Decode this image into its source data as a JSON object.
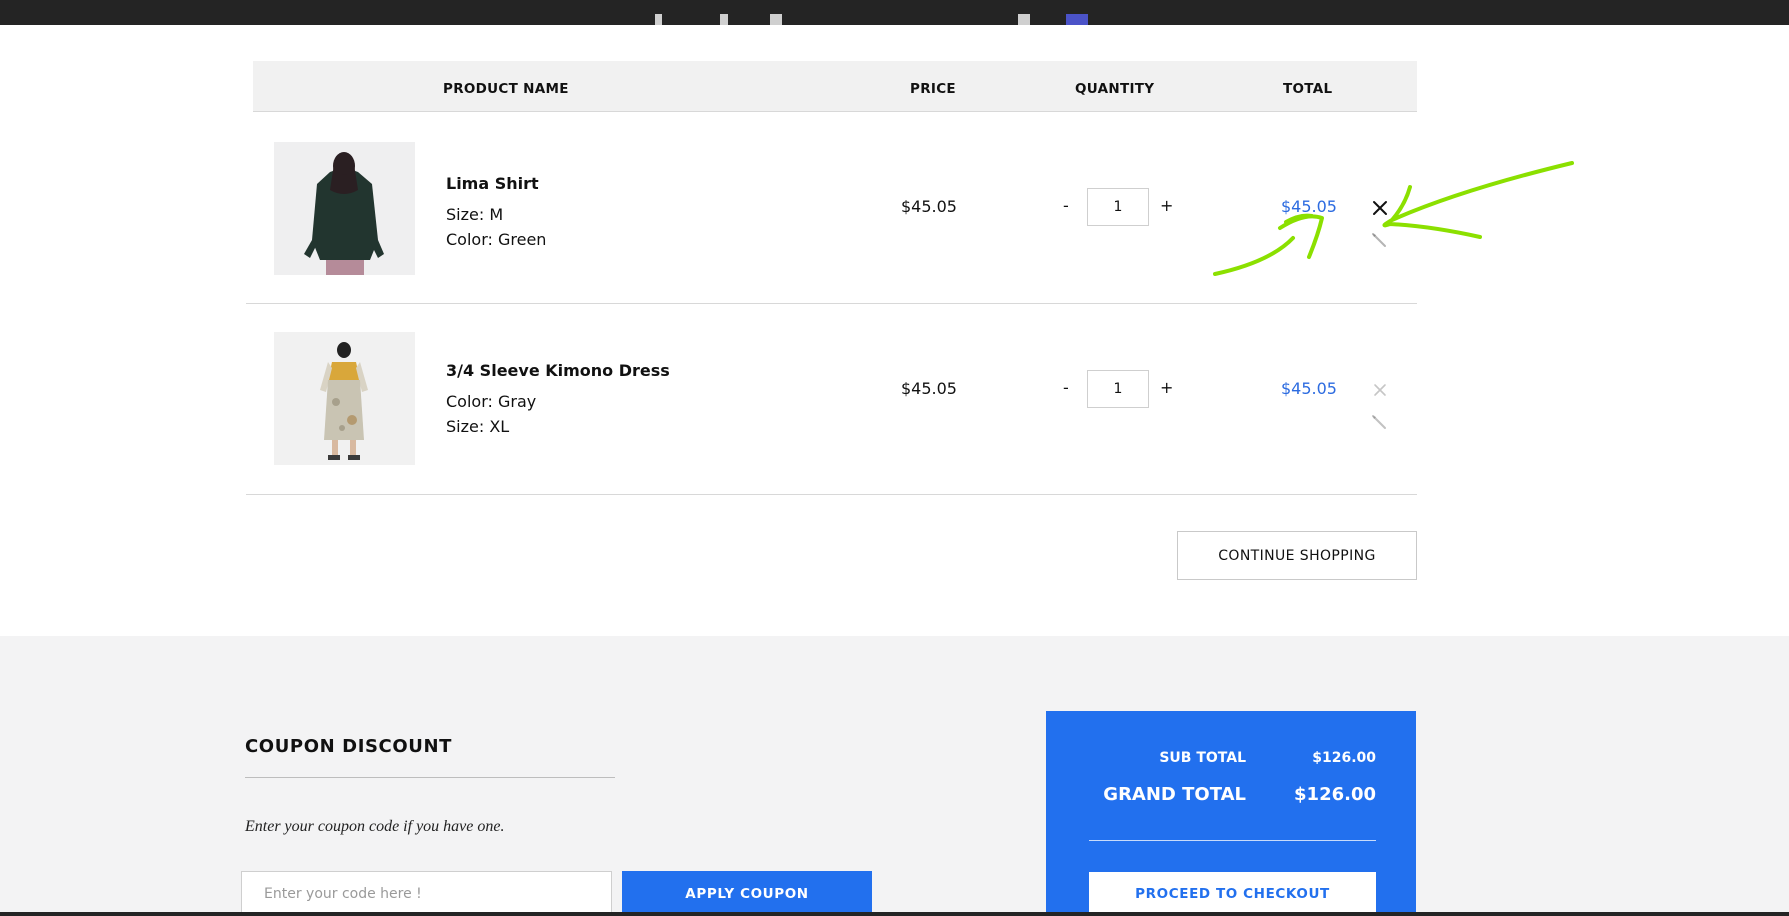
{
  "cart": {
    "headers": {
      "product": "PRODUCT NAME",
      "price": "PRICE",
      "quantity": "QUANTITY",
      "total": "TOTAL"
    },
    "items": [
      {
        "name": "Lima Shirt",
        "attr1": "Size: M",
        "attr2": "Color: Green",
        "price": "$45.05",
        "qty": "1",
        "minus": "-",
        "plus": "+",
        "total": "$45.05",
        "image_icon": "shirt-back-photo"
      },
      {
        "name": "3/4 Sleeve Kimono Dress",
        "attr1": "Color: Gray",
        "attr2": "Size: XL",
        "price": "$45.05",
        "qty": "1",
        "minus": "-",
        "plus": "+",
        "total": "$45.05",
        "image_icon": "dress-back-photo"
      }
    ],
    "continue_label": "CONTINUE SHOPPING"
  },
  "coupon": {
    "title": "COUPON DISCOUNT",
    "hint": "Enter your coupon code if you have one.",
    "placeholder": "Enter your code here !",
    "apply_label": "APPLY COUPON"
  },
  "summary": {
    "subtotal_label": "SUB TOTAL",
    "subtotal_value": "$126.00",
    "grand_label": "GRAND TOTAL",
    "grand_value": "$126.00",
    "checkout_label": "PROCEED TO CHECKOUT"
  },
  "colors": {
    "accent": "#2270ee",
    "link_total": "#2c6be0",
    "annotation": "#8be000",
    "top_bar": "#242424"
  }
}
